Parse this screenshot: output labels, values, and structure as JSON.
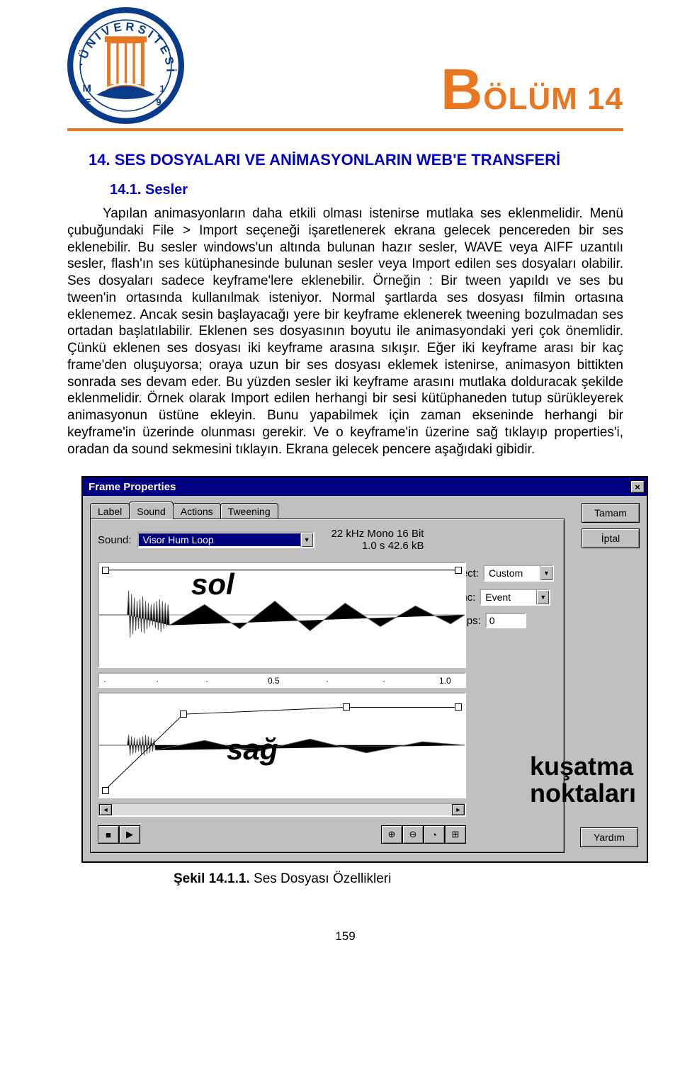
{
  "chapter": {
    "prefix": "B",
    "rest": "ÖLÜM 14"
  },
  "h1": "14. SES DOSYALARI VE ANİMASYONLARIN WEB'E TRANSFERİ",
  "h2": "14.1. Sesler",
  "para": "Yapılan animasyonların daha etkili olması istenirse mutlaka ses eklenmelidir. Menü çubuğundaki File > Import seçeneği işaretlenerek ekrana gelecek pencereden bir ses eklenebilir. Bu sesler windows'un altında bulunan hazır sesler, WAVE veya AIFF uzantılı sesler, flash'ın ses kütüphanesinde bulunan sesler veya Import edilen ses dosyaları olabilir. Ses dosyaları sadece keyframe'lere eklenebilir. Örneğin : Bir tween yapıldı ve ses bu tween'in ortasında kullanılmak isteniyor. Normal şartlarda ses dosyası filmin ortasına eklenemez. Ancak sesin başlayacağı yere bir keyframe eklenerek tweening bozulmadan ses ortadan başlatılabilir. Eklenen ses dosyasının boyutu ile animasyondaki yeri çok önemlidir. Çünkü eklenen ses dosyası iki keyframe arasına sıkışır. Eğer iki keyframe arası bir kaç frame'den oluşuyorsa; oraya uzun bir ses dosyası eklemek istenirse, animasyon bittikten sonrada ses devam eder. Bu yüzden sesler iki keyframe arasını mutlaka dolduracak şekilde eklenmelidir. Örnek olarak Import edilen herhangi bir sesi kütüphaneden tutup sürükleyerek animasyonun üstüne ekleyin. Bunu yapabilmek için zaman ekseninde herhangi bir keyframe'in üzerinde olunması gerekir. Ve o keyframe'in üzerine sağ tıklayıp properties'i, oradan da sound sekmesini tıklayın. Ekrana gelecek pencere aşağıdaki gibidir.",
  "caption_bold": "Şekil 14.1.1.",
  "caption_rest": " Ses Dosyası Özellikleri",
  "page_number": "159",
  "dialog": {
    "title": "Frame Properties",
    "tabs": {
      "label": "Label",
      "sound": "Sound",
      "actions": "Actions",
      "tweening": "Tweening"
    },
    "buttons": {
      "ok": "Tamam",
      "cancel": "İptal",
      "help": "Yardım"
    },
    "sound_label": "Sound:",
    "sound_value": "Visor Hum Loop",
    "info_line1": "22 kHz Mono 16 Bit",
    "info_line2": "1.0 s 42.6 kB",
    "effect_label": "Effect:",
    "effect_value": "Custom",
    "sync_label": "Sync:",
    "sync_value": "Event",
    "loops_label": "Loops:",
    "loops_value": "0",
    "wave_left": "sol",
    "wave_right": "sağ",
    "ruler_mid": "0.5",
    "ruler_end": "1.0",
    "overlay": "kuşatma\nnoktaları"
  }
}
